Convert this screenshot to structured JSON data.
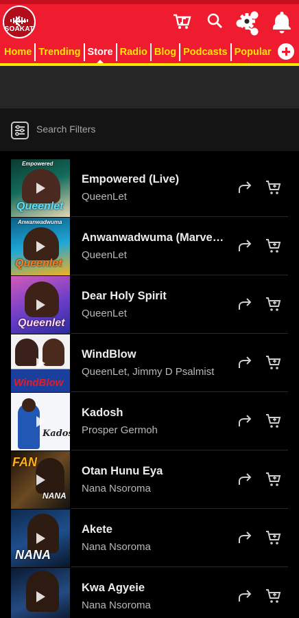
{
  "app": {
    "logo_text": "SOAKAT",
    "colors": {
      "primary_red": "#ee1c2e",
      "nav_yellow": "#ffe600",
      "toolbar": "#262626",
      "background": "#000000"
    }
  },
  "header": {
    "icons": [
      "share-icon",
      "bell-icon"
    ]
  },
  "nav": {
    "items": [
      "Home",
      "Trending",
      "Store",
      "Radio",
      "Blog",
      "Podcasts",
      "Popular"
    ],
    "active": "Store"
  },
  "toolbar": {
    "icons": [
      "back-arrow-icon",
      "playlist-cart-icon",
      "search-icon",
      "gear-icon",
      "user-icon"
    ]
  },
  "filters": {
    "label": "Search Filters"
  },
  "tracks": [
    {
      "title": "Empowered (Live)",
      "artist": "QueenLet",
      "cover_caption": "Queenlet",
      "cover_top": "Empowered"
    },
    {
      "title": "Anwanwadwuma (Marvellous)",
      "artist": "QueenLet",
      "cover_caption": "Queenlet",
      "cover_top": "Anwanwadwuma"
    },
    {
      "title": "Dear Holy Spirit",
      "artist": "QueenLet",
      "cover_caption": "Queenlet",
      "cover_top": ""
    },
    {
      "title": "WindBlow",
      "artist": "QueenLet, Jimmy D Psalmist",
      "cover_caption": "WindBlow",
      "cover_top": ""
    },
    {
      "title": "Kadosh",
      "artist": "Prosper Germoh",
      "cover_caption": "Kadosh",
      "cover_top": ""
    },
    {
      "title": "Otan Hunu Eya",
      "artist": "Nana Nsoroma",
      "cover_caption": "NANA",
      "cover_top": "FAN"
    },
    {
      "title": "Akete",
      "artist": "Nana Nsoroma",
      "cover_caption": "NANA",
      "cover_top": ""
    },
    {
      "title": "Kwa Agyeie",
      "artist": "Nana Nsoroma",
      "cover_caption": "",
      "cover_top": ""
    }
  ]
}
